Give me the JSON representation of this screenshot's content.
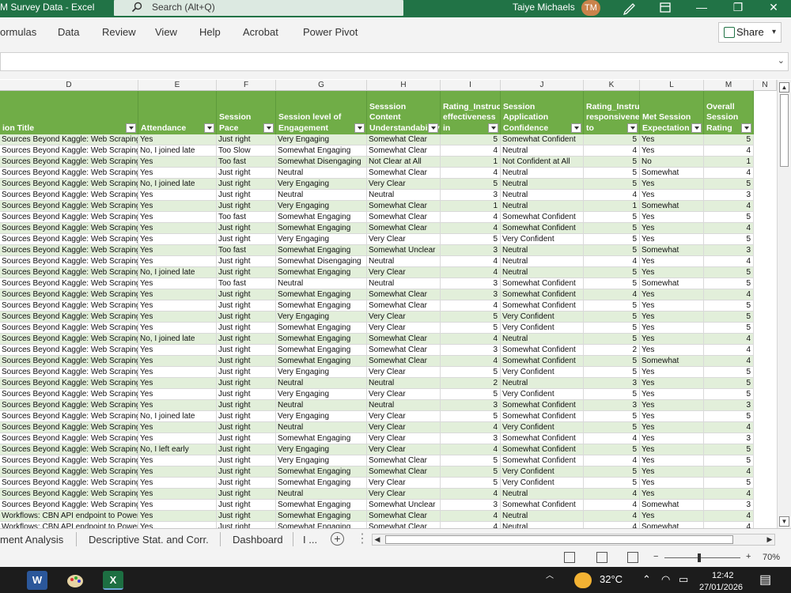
{
  "window": {
    "doc_title": "M Survey Data  -  Excel",
    "search_placeholder": "Search (Alt+Q)",
    "user_name": "Taiye Michaels",
    "user_initials": "TM",
    "pen_icon": "pen-icon",
    "restore_icon": "ribbon-display-icon",
    "minimize_glyph": "—",
    "maximize_glyph": "❐",
    "close_glyph": "✕"
  },
  "ribbon": {
    "tabs": [
      "ormulas",
      "Data",
      "Review",
      "View",
      "Help",
      "Acrobat",
      "Power Pivot"
    ],
    "share_label": "Share"
  },
  "columns": [
    "D",
    "E",
    "F",
    "G",
    "H",
    "I",
    "J",
    "K",
    "L",
    "M",
    "N"
  ],
  "table": {
    "headers": [
      "ion Title",
      "Attendance",
      "Session Pace",
      "Session level of Engagement",
      "Sesssion Content Understandability",
      "Rating_Instructor's effectiveness in",
      "Session Application Confidence",
      "Rating_Instructor's responsiveness to",
      "Met Session Expectation",
      "Overall Session Rating"
    ],
    "rows": [
      [
        "Sources Beyond Kaggle: Web Scraping",
        "Yes",
        "Just right",
        "Very Engaging",
        "Somewhat Clear",
        "5",
        "Somewhat Confident",
        "5",
        "Yes",
        "5"
      ],
      [
        "Sources Beyond Kaggle: Web Scraping",
        "No, I joined late",
        "Too Slow",
        "Somewhat Engaging",
        "Somewhat Clear",
        "4",
        "Neutral",
        "4",
        "Yes",
        "4"
      ],
      [
        "Sources Beyond Kaggle: Web Scraping",
        "Yes",
        "Too fast",
        "Somewhat Disengaging",
        "Not Clear at All",
        "1",
        "Not Confident at All",
        "5",
        "No",
        "1"
      ],
      [
        "Sources Beyond Kaggle: Web Scraping",
        "Yes",
        "Just right",
        "Neutral",
        "Somewhat Clear",
        "4",
        "Neutral",
        "5",
        "Somewhat",
        "4"
      ],
      [
        "Sources Beyond Kaggle: Web Scraping",
        "No, I joined late",
        "Just right",
        "Very Engaging",
        "Very Clear",
        "5",
        "Neutral",
        "5",
        "Yes",
        "5"
      ],
      [
        "Sources Beyond Kaggle: Web Scraping",
        "Yes",
        "Just right",
        "Neutral",
        "Neutral",
        "3",
        "Neutral",
        "4",
        "Yes",
        "3"
      ],
      [
        "Sources Beyond Kaggle: Web Scraping",
        "Yes",
        "Just right",
        "Very Engaging",
        "Somewhat Clear",
        "1",
        "Neutral",
        "1",
        "Somewhat",
        "4"
      ],
      [
        "Sources Beyond Kaggle: Web Scraping",
        "Yes",
        "Too fast",
        "Somewhat Engaging",
        "Somewhat Clear",
        "4",
        "Somewhat Confident",
        "5",
        "Yes",
        "5"
      ],
      [
        "Sources Beyond Kaggle: Web Scraping",
        "Yes",
        "Just right",
        "Somewhat Engaging",
        "Somewhat Clear",
        "4",
        "Somewhat Confident",
        "5",
        "Yes",
        "4"
      ],
      [
        "Sources Beyond Kaggle: Web Scraping",
        "Yes",
        "Just right",
        "Very Engaging",
        "Very Clear",
        "5",
        "Very Confident",
        "5",
        "Yes",
        "5"
      ],
      [
        "Sources Beyond Kaggle: Web Scraping",
        "Yes",
        "Too fast",
        "Somewhat Engaging",
        "Somewhat Unclear",
        "3",
        "Neutral",
        "5",
        "Somewhat",
        "3"
      ],
      [
        "Sources Beyond Kaggle: Web Scraping",
        "Yes",
        "Just right",
        "Somewhat Disengaging",
        "Neutral",
        "4",
        "Neutral",
        "4",
        "Yes",
        "4"
      ],
      [
        "Sources Beyond Kaggle: Web Scraping",
        "No, I joined late",
        "Just right",
        "Somewhat Engaging",
        "Very Clear",
        "4",
        "Neutral",
        "5",
        "Yes",
        "5"
      ],
      [
        "Sources Beyond Kaggle: Web Scraping",
        "Yes",
        "Too fast",
        "Neutral",
        "Neutral",
        "3",
        "Somewhat Confident",
        "5",
        "Somewhat",
        "5"
      ],
      [
        "Sources Beyond Kaggle: Web Scraping",
        "Yes",
        "Just right",
        "Somewhat Engaging",
        "Somewhat Clear",
        "3",
        "Somewhat Confident",
        "4",
        "Yes",
        "4"
      ],
      [
        "Sources Beyond Kaggle: Web Scraping",
        "Yes",
        "Just right",
        "Somewhat Engaging",
        "Somewhat Clear",
        "4",
        "Somewhat Confident",
        "5",
        "Yes",
        "5"
      ],
      [
        "Sources Beyond Kaggle: Web Scraping",
        "Yes",
        "Just right",
        "Very Engaging",
        "Very Clear",
        "5",
        "Very Confident",
        "5",
        "Yes",
        "5"
      ],
      [
        "Sources Beyond Kaggle: Web Scraping",
        "Yes",
        "Just right",
        "Somewhat Engaging",
        "Very Clear",
        "5",
        "Very Confident",
        "5",
        "Yes",
        "5"
      ],
      [
        "Sources Beyond Kaggle: Web Scraping",
        "No, I joined late",
        "Just right",
        "Somewhat Engaging",
        "Somewhat Clear",
        "4",
        "Neutral",
        "5",
        "Yes",
        "4"
      ],
      [
        "Sources Beyond Kaggle: Web Scraping",
        "Yes",
        "Just right",
        "Somewhat Engaging",
        "Somewhat Clear",
        "3",
        "Somewhat Confident",
        "2",
        "Yes",
        "4"
      ],
      [
        "Sources Beyond Kaggle: Web Scraping",
        "Yes",
        "Just right",
        "Somewhat Engaging",
        "Somewhat Clear",
        "4",
        "Somewhat Confident",
        "5",
        "Somewhat",
        "4"
      ],
      [
        "Sources Beyond Kaggle: Web Scraping",
        "Yes",
        "Just right",
        "Very Engaging",
        "Very Clear",
        "5",
        "Very Confident",
        "5",
        "Yes",
        "5"
      ],
      [
        "Sources Beyond Kaggle: Web Scraping",
        "Yes",
        "Just right",
        "Neutral",
        "Neutral",
        "2",
        "Neutral",
        "3",
        "Yes",
        "5"
      ],
      [
        "Sources Beyond Kaggle: Web Scraping",
        "Yes",
        "Just right",
        "Very Engaging",
        "Very Clear",
        "5",
        "Very Confident",
        "5",
        "Yes",
        "5"
      ],
      [
        "Sources Beyond Kaggle: Web Scraping",
        "Yes",
        "Just right",
        "Neutral",
        "Neutral",
        "3",
        "Somewhat Confident",
        "3",
        "Yes",
        "3"
      ],
      [
        "Sources Beyond Kaggle: Web Scraping",
        "No, I joined late",
        "Just right",
        "Very Engaging",
        "Very Clear",
        "5",
        "Somewhat Confident",
        "5",
        "Yes",
        "5"
      ],
      [
        "Sources Beyond Kaggle: Web Scraping",
        "Yes",
        "Just right",
        "Neutral",
        "Very Clear",
        "4",
        "Very Confident",
        "5",
        "Yes",
        "4"
      ],
      [
        "Sources Beyond Kaggle: Web Scraping",
        "Yes",
        "Just right",
        "Somewhat Engaging",
        "Very Clear",
        "3",
        "Somewhat Confident",
        "4",
        "Yes",
        "3"
      ],
      [
        "Sources Beyond Kaggle: Web Scraping",
        "No, I left early",
        "Just right",
        "Very Engaging",
        "Very Clear",
        "4",
        "Somewhat Confident",
        "5",
        "Yes",
        "5"
      ],
      [
        "Sources Beyond Kaggle: Web Scraping",
        "Yes",
        "Just right",
        "Very Engaging",
        "Somewhat Clear",
        "5",
        "Somewhat Confident",
        "4",
        "Yes",
        "5"
      ],
      [
        "Sources Beyond Kaggle: Web Scraping",
        "Yes",
        "Just right",
        "Somewhat Engaging",
        "Somewhat Clear",
        "5",
        "Very Confident",
        "5",
        "Yes",
        "4"
      ],
      [
        "Sources Beyond Kaggle: Web Scraping",
        "Yes",
        "Just right",
        "Somewhat Engaging",
        "Very Clear",
        "5",
        "Very Confident",
        "5",
        "Yes",
        "5"
      ],
      [
        "Sources Beyond Kaggle: Web Scraping",
        "Yes",
        "Just right",
        "Neutral",
        "Very Clear",
        "4",
        "Neutral",
        "4",
        "Yes",
        "4"
      ],
      [
        "Sources Beyond Kaggle: Web Scraping",
        "Yes",
        "Just right",
        "Somewhat Engaging",
        "Somewhat Unclear",
        "3",
        "Somewhat Confident",
        "4",
        "Somewhat",
        "3"
      ],
      [
        "Workflows: CBN API endpoint to Power",
        "Yes",
        "Just right",
        "Somewhat Engaging",
        "Somewhat Clear",
        "4",
        "Neutral",
        "4",
        "Yes",
        "4"
      ],
      [
        "Workflows: CBN API endpoint to Power",
        "Yes",
        "Just right",
        "Somewhat Engaging",
        "Somewhat Clear",
        "4",
        "Neutral",
        "4",
        "Somewhat",
        "4"
      ]
    ]
  },
  "sheets": {
    "tabs": [
      "ment Analysis",
      "Descriptive Stat. and Corr.",
      "Dashboard",
      "I ..."
    ],
    "add_glyph": "+"
  },
  "statusbar": {
    "zoom_minus": "−",
    "zoom_plus": "+",
    "zoom_level": "70%",
    "zoom_fraction": 0.46
  },
  "taskbar": {
    "temperature": "32°C",
    "time": "12:42",
    "date": "27/01/2026",
    "word_label": "W",
    "excel_label": "X",
    "paint_icon": "paint-icon",
    "notification_glyph": "▤"
  },
  "colors": {
    "excel_green": "#217346",
    "table_header": "#70ad47",
    "band_row": "#e2efda"
  }
}
